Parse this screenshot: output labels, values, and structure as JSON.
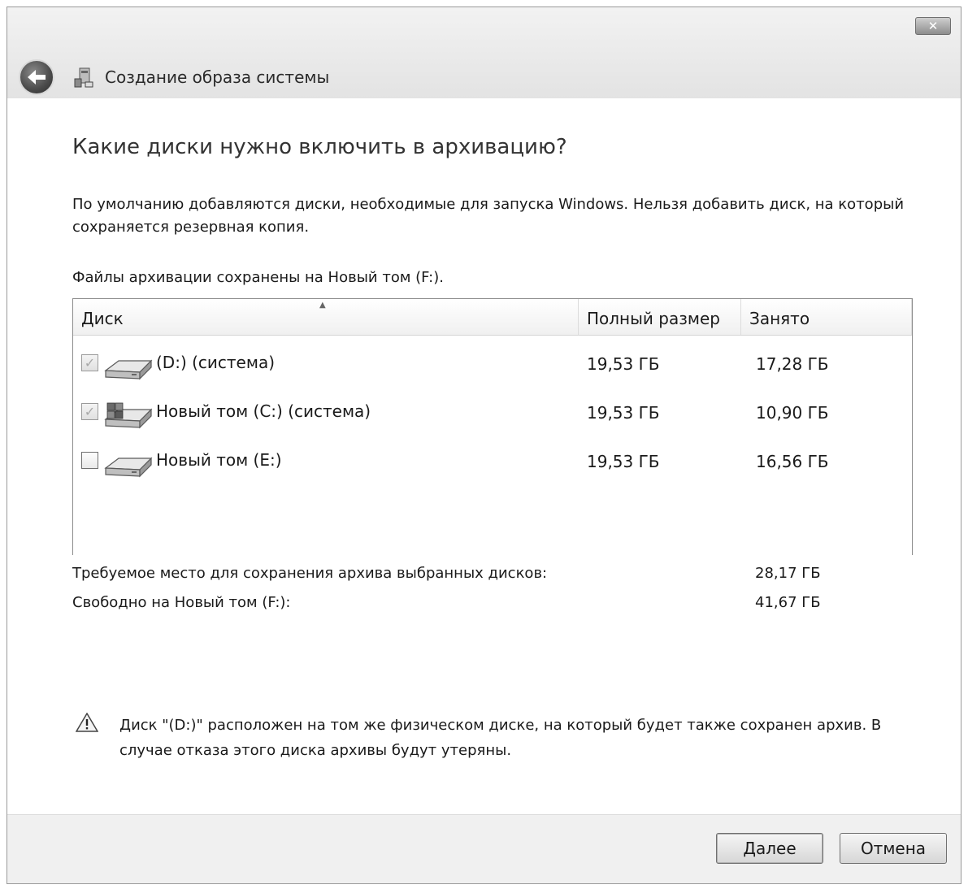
{
  "window": {
    "title": "Создание образа системы",
    "close_label": "✕"
  },
  "main": {
    "heading": "Какие диски нужно включить в архивацию?",
    "description": "По умолчанию добавляются диски, необходимые для запуска Windows. Нельзя добавить диск, на который сохраняется резервная копия.",
    "saved_to": "Файлы архивации сохранены на Новый том (F:)."
  },
  "table": {
    "columns": {
      "disk": "Диск",
      "total": "Полный размер",
      "used": "Занято"
    },
    "rows": [
      {
        "name": "(D:) (система)",
        "total": "19,53 ГБ",
        "used": "17,28 ГБ",
        "checked": true,
        "disabled": true,
        "icon": "drive-icon"
      },
      {
        "name": "Новый том (C:) (система)",
        "total": "19,53 ГБ",
        "used": "10,90 ГБ",
        "checked": true,
        "disabled": true,
        "icon": "windows-drive-icon"
      },
      {
        "name": "Новый том (E:)",
        "total": "19,53 ГБ",
        "used": "16,56 ГБ",
        "checked": false,
        "disabled": false,
        "icon": "drive-icon"
      }
    ]
  },
  "summary": {
    "required_label": "Требуемое место для сохранения архива выбранных дисков:",
    "required_value": "28,17 ГБ",
    "free_label": "Свободно на Новый том (F:):",
    "free_value": "41,67 ГБ"
  },
  "warning": {
    "icon": "warning-icon",
    "text": "Диск \"(D:)\" расположен на том же физическом диске, на который будет также сохранен архив. В случае отказа этого диска архивы будут утеряны."
  },
  "footer": {
    "next_label": "Далее",
    "cancel_label": "Отмена"
  }
}
